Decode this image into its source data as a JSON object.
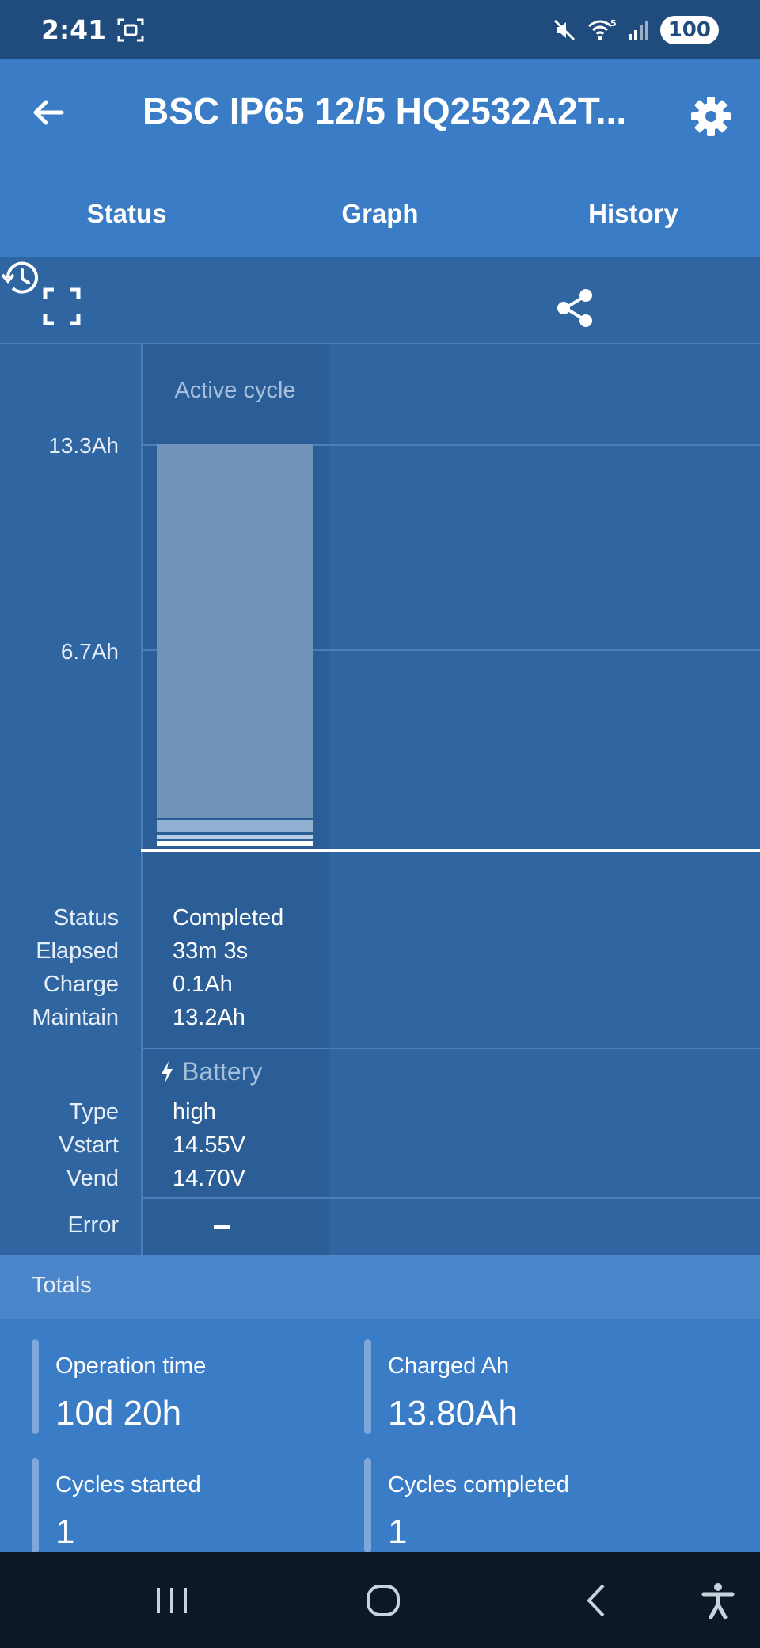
{
  "status_bar": {
    "time": "2:41",
    "battery": "100"
  },
  "app_bar": {
    "title": "BSC IP65 12/5 HQ2532A2T...",
    "tabs": [
      {
        "label": "Status"
      },
      {
        "label": "Graph"
      },
      {
        "label": "History"
      }
    ]
  },
  "graph": {
    "column_header": "Active cycle",
    "y_labels": [
      "13.3Ah",
      "6.7Ah"
    ],
    "rows": [
      {
        "label": "Status",
        "value": "Completed"
      },
      {
        "label": "Elapsed",
        "value": "33m 3s"
      },
      {
        "label": "Charge",
        "value": "0.1Ah"
      },
      {
        "label": "Maintain",
        "value": "13.2Ah"
      }
    ],
    "battery_header": "Battery",
    "battery_rows": [
      {
        "label": "Type",
        "value": "high"
      },
      {
        "label": "Vstart",
        "value": "14.55V"
      },
      {
        "label": "Vend",
        "value": "14.70V"
      }
    ],
    "error_label": "Error"
  },
  "totals": {
    "header": "Totals",
    "items": [
      {
        "label": "Operation time",
        "value": "10d 20h"
      },
      {
        "label": "Charged Ah",
        "value": "13.80Ah"
      },
      {
        "label": "Cycles started",
        "value": "1"
      },
      {
        "label": "Cycles completed",
        "value": "1"
      }
    ]
  },
  "icons": {
    "back": "arrow-left-icon",
    "settings": "gear-icon",
    "expand": "expand-icon",
    "share": "share-icon",
    "history": "history-icon"
  }
}
